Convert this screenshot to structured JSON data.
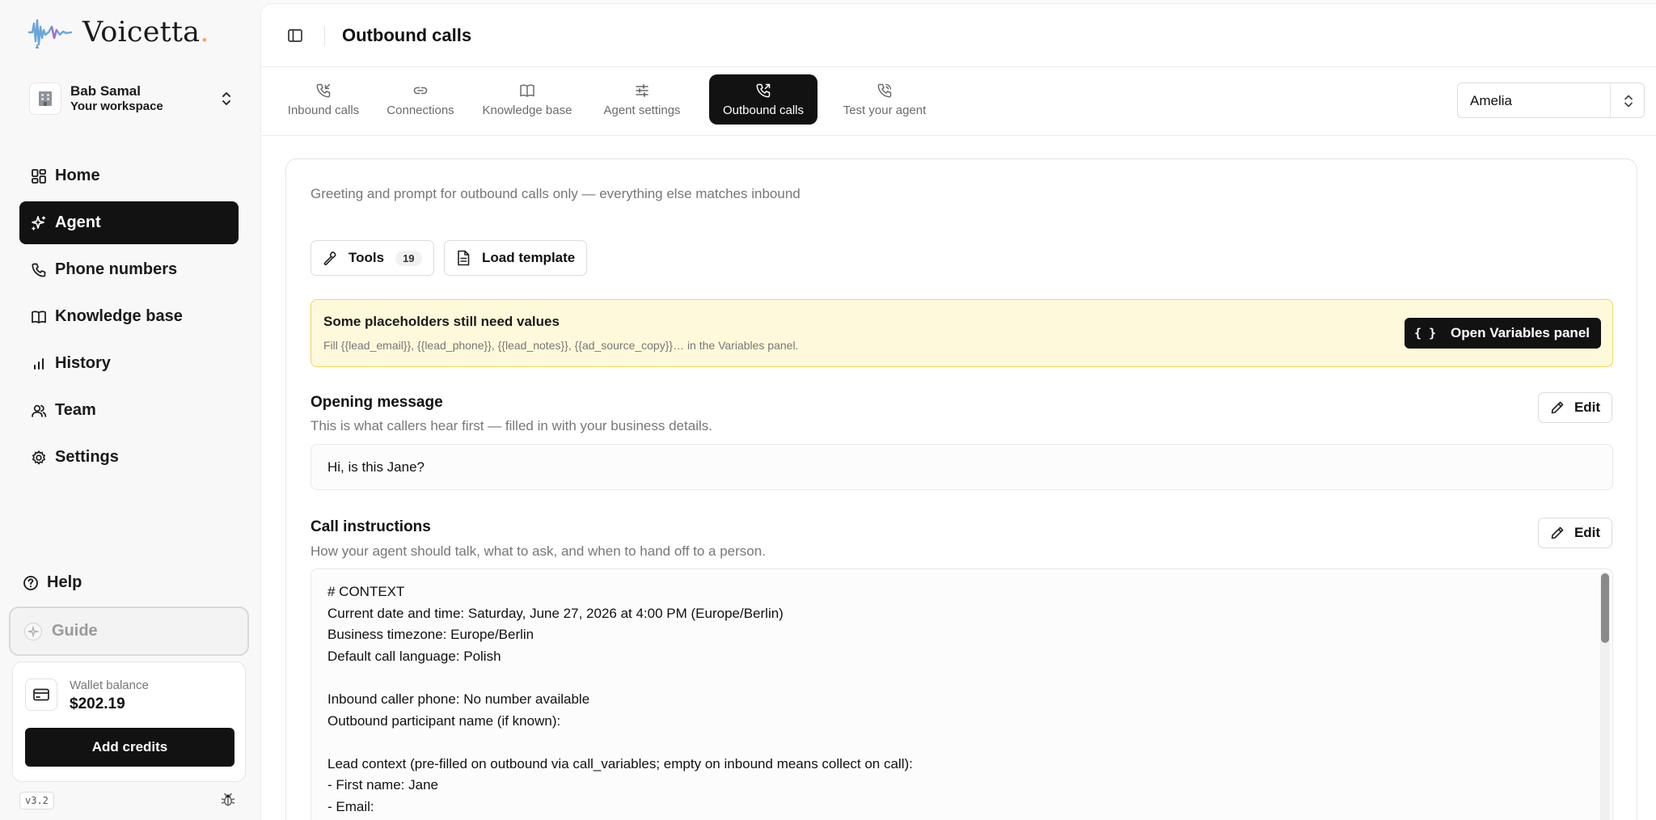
{
  "app": {
    "logo_text": "Voicetta",
    "logo_dot": "."
  },
  "workspace": {
    "name": "Bab Samal",
    "subtitle": "Your workspace"
  },
  "nav": {
    "items": [
      {
        "label": "Home",
        "icon": "dashboard-icon"
      },
      {
        "label": "Agent",
        "icon": "sparkle-icon",
        "active": true
      },
      {
        "label": "Phone numbers",
        "icon": "phone-icon"
      },
      {
        "label": "Knowledge base",
        "icon": "book-icon"
      },
      {
        "label": "History",
        "icon": "bar-chart-icon"
      },
      {
        "label": "Team",
        "icon": "users-icon"
      },
      {
        "label": "Settings",
        "icon": "gear-icon"
      }
    ]
  },
  "help": {
    "label": "Help"
  },
  "guide": {
    "label": "Guide"
  },
  "wallet": {
    "label": "Wallet balance",
    "amount": "$202.19",
    "add_credits_label": "Add credits"
  },
  "version": "v3.2",
  "header": {
    "title": "Outbound calls"
  },
  "tabs": [
    {
      "label": "Inbound calls",
      "icon": "phone-incoming-icon"
    },
    {
      "label": "Connections",
      "icon": "link-icon"
    },
    {
      "label": "Knowledge base",
      "icon": "book-open-icon"
    },
    {
      "label": "Agent settings",
      "icon": "sliders-icon"
    },
    {
      "label": "Outbound calls",
      "icon": "phone-outgoing-icon",
      "active": true
    },
    {
      "label": "Test your agent",
      "icon": "phone-call-icon"
    }
  ],
  "agent_select": {
    "value": "Amelia"
  },
  "card": {
    "subtitle": "Greeting and prompt for outbound calls only — everything else matches inbound",
    "tools_label": "Tools",
    "tools_count": "19",
    "load_template_label": "Load template"
  },
  "warning": {
    "title": "Some placeholders still need values",
    "description": "Fill {{lead_email}}, {{lead_phone}}, {{lead_notes}}, {{ad_source_copy}}… in the Variables panel.",
    "button_label": "Open Variables panel",
    "button_glyph": "{ }"
  },
  "opening": {
    "title": "Opening message",
    "description": "This is what callers hear first — filled in with your business details.",
    "edit_label": "Edit",
    "value": "Hi, is this Jane?"
  },
  "instructions": {
    "title": "Call instructions",
    "description": "How your agent should talk, what to ask, and when to hand off to a person.",
    "edit_label": "Edit",
    "lines": [
      "# CONTEXT",
      "Current date and time: Saturday, June 27, 2026 at 4:00 PM (Europe/Berlin)",
      "Business timezone: Europe/Berlin",
      "Default call language: Polish",
      "",
      "Inbound caller phone: No number available",
      "Outbound participant name (if known):",
      "",
      "Lead context (pre-filled on outbound via call_variables; empty on inbound means collect on call):",
      "- First name: Jane",
      "- Email:"
    ]
  },
  "colors": {
    "accent": "#121212",
    "warning_bg": "#fff9db",
    "warning_border": "#f1d55e",
    "logo_wave": "#6aa6d8"
  }
}
